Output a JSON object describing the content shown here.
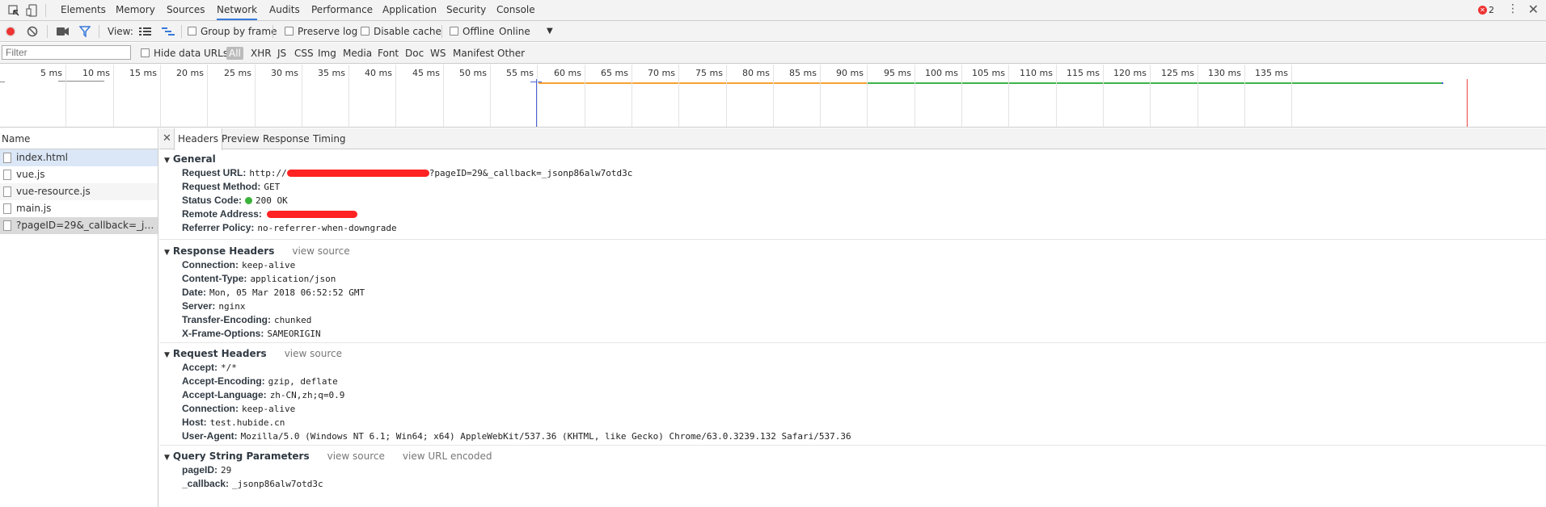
{
  "top_tabs": [
    "Elements",
    "Memory",
    "Sources",
    "Network",
    "Audits",
    "Performance",
    "Application",
    "Security",
    "Console"
  ],
  "active_tab": "Network",
  "error_count": "2",
  "toolbar": {
    "view_label": "View:",
    "group_by_frame": "Group by frame",
    "preserve_log": "Preserve log",
    "disable_cache": "Disable cache",
    "offline": "Offline",
    "throttle": "Online"
  },
  "filter": {
    "placeholder": "Filter",
    "hide_data_urls": "Hide data URLs",
    "types": [
      "All",
      "XHR",
      "JS",
      "CSS",
      "Img",
      "Media",
      "Font",
      "Doc",
      "WS",
      "Manifest",
      "Other"
    ]
  },
  "timeline_ticks": [
    "5 ms",
    "10 ms",
    "15 ms",
    "20 ms",
    "25 ms",
    "30 ms",
    "35 ms",
    "40 ms",
    "45 ms",
    "50 ms",
    "55 ms",
    "60 ms",
    "65 ms",
    "70 ms",
    "75 ms",
    "80 ms",
    "85 ms",
    "90 ms",
    "95 ms",
    "100 ms",
    "105 ms",
    "110 ms",
    "115 ms",
    "120 ms",
    "125 ms",
    "130 ms",
    "135 ms"
  ],
  "timeline_colors": {
    "waiting": "#f6a235",
    "download": "#3cb44b",
    "dcl": "#4a60d8",
    "load": "#e44"
  },
  "list": {
    "header": "Name",
    "rows": [
      "index.html",
      "vue.js",
      "vue-resource.js",
      "main.js",
      "?pageID=29&_callback=_json..."
    ]
  },
  "detail_tabs": [
    "Headers",
    "Preview",
    "Response",
    "Timing"
  ],
  "general": {
    "title": "General",
    "request_url_key": "Request URL:",
    "request_url_prefix": "http://",
    "request_url_suffix": "?pageID=29&_callback=_jsonp86alw7otd3c",
    "method_key": "Request Method:",
    "method": "GET",
    "status_key": "Status Code:",
    "status": "200 OK",
    "remote_key": "Remote Address:",
    "referrer_key": "Referrer Policy:",
    "referrer": "no-referrer-when-downgrade"
  },
  "response_headers": {
    "title": "Response Headers",
    "view_source": "view source",
    "items": [
      {
        "k": "Connection:",
        "v": "keep-alive"
      },
      {
        "k": "Content-Type:",
        "v": "application/json"
      },
      {
        "k": "Date:",
        "v": "Mon, 05 Mar 2018 06:52:52 GMT"
      },
      {
        "k": "Server:",
        "v": "nginx"
      },
      {
        "k": "Transfer-Encoding:",
        "v": "chunked"
      },
      {
        "k": "X-Frame-Options:",
        "v": "SAMEORIGIN"
      }
    ]
  },
  "request_headers": {
    "title": "Request Headers",
    "view_source": "view source",
    "items": [
      {
        "k": "Accept:",
        "v": "*/*"
      },
      {
        "k": "Accept-Encoding:",
        "v": "gzip, deflate"
      },
      {
        "k": "Accept-Language:",
        "v": "zh-CN,zh;q=0.9"
      },
      {
        "k": "Connection:",
        "v": "keep-alive"
      },
      {
        "k": "Host:",
        "v": "test.hubide.cn"
      },
      {
        "k": "User-Agent:",
        "v": "Mozilla/5.0 (Windows NT 6.1; Win64; x64) AppleWebKit/537.36 (KHTML, like Gecko) Chrome/63.0.3239.132 Safari/537.36"
      }
    ]
  },
  "query_params": {
    "title": "Query String Parameters",
    "view_source": "view source",
    "view_url_encoded": "view URL encoded",
    "items": [
      {
        "k": "pageID:",
        "v": "29"
      },
      {
        "k": "_callback:",
        "v": "_jsonp86alw7otd3c"
      }
    ]
  }
}
